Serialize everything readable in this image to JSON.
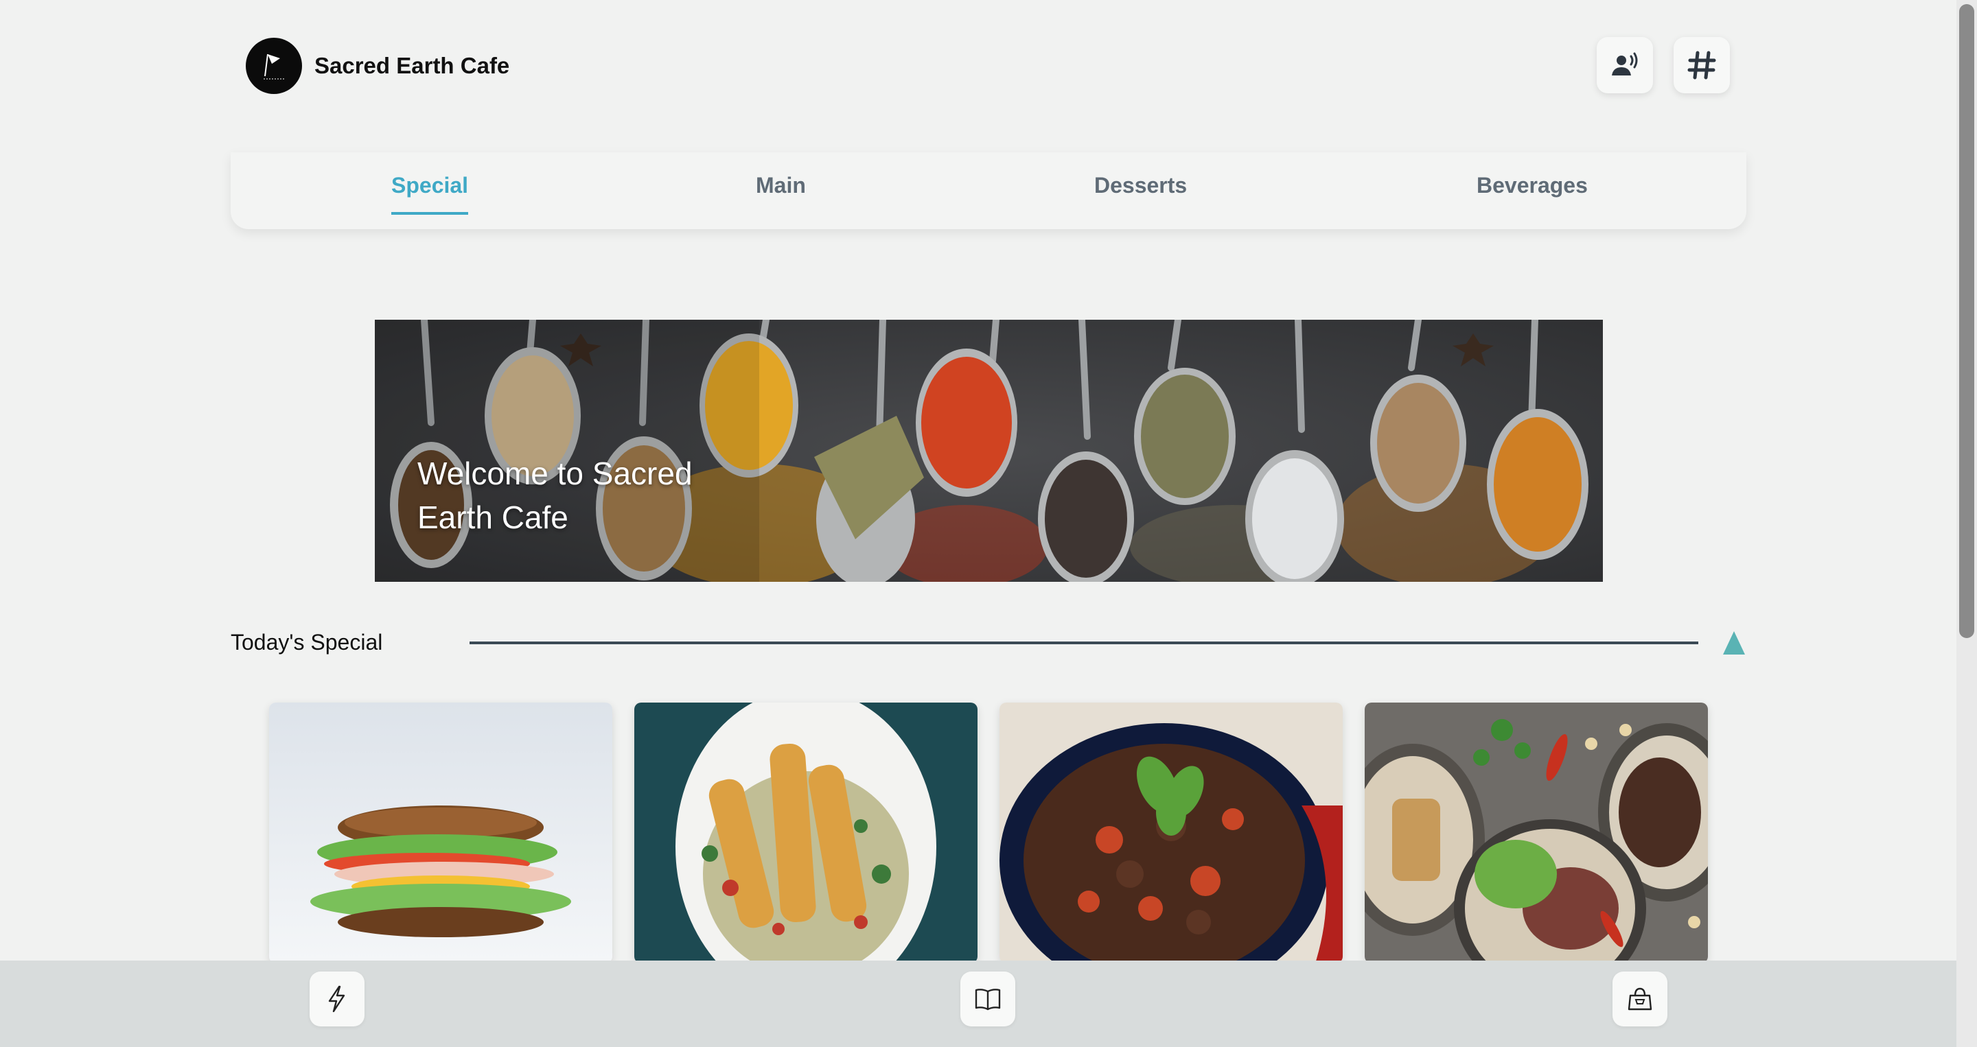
{
  "header": {
    "brand": "Sacred Earth Cafe",
    "logo_icon": "flag-logo-icon",
    "buttons": [
      {
        "name": "call-waiter-button",
        "icon": "waiter-bell-icon"
      },
      {
        "name": "table-number-button",
        "icon": "hash-icon"
      }
    ]
  },
  "tabs": [
    {
      "label": "Special",
      "active": true
    },
    {
      "label": "Main",
      "active": false
    },
    {
      "label": "Desserts",
      "active": false
    },
    {
      "label": "Beverages",
      "active": false
    }
  ],
  "banner": {
    "title": "Welcome to Sacred Earth Cafe"
  },
  "section": {
    "title": "Today's Special",
    "toggle_icon": "triangle-up-icon"
  },
  "specials": [
    {
      "image": "sandwich-photo"
    },
    {
      "image": "skewers-photo"
    },
    {
      "image": "stir-fry-bowl-photo"
    },
    {
      "image": "platter-photo"
    }
  ],
  "bottom_nav": [
    {
      "name": "quick-order-button",
      "icon": "lightning-icon"
    },
    {
      "name": "menu-button",
      "icon": "book-icon"
    },
    {
      "name": "cart-button",
      "icon": "shopping-bag-icon"
    }
  ],
  "colors": {
    "background": "#f1f2f1",
    "accent": "#3fa9c6",
    "tab_text": "#5f6b76",
    "divider": "#3b4a55",
    "toggle": "#5ab3b4",
    "bottom_bar": "#d8dcdc"
  }
}
